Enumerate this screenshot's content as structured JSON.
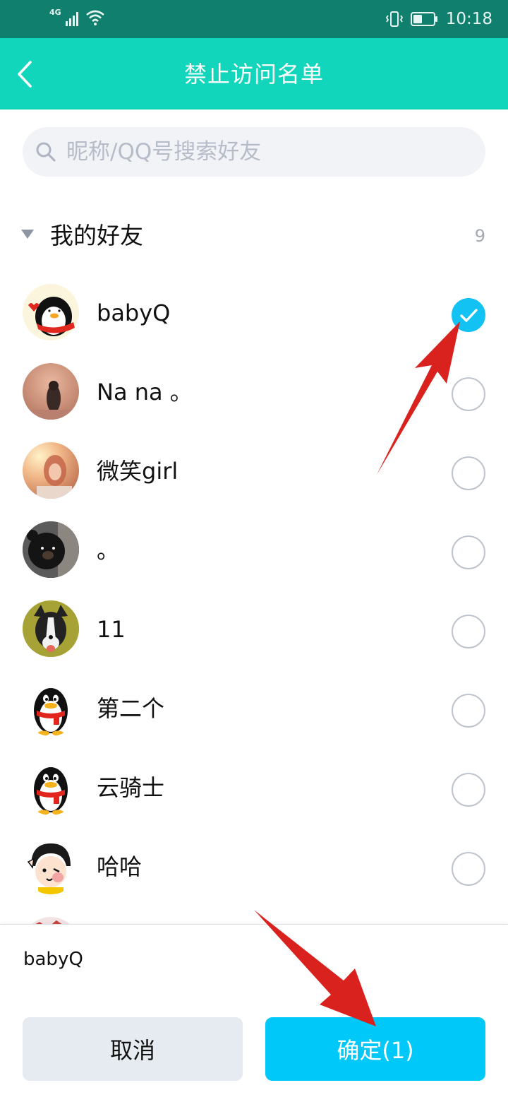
{
  "status_bar": {
    "network": "4G",
    "time": "10:18",
    "icons": [
      "signal-icon",
      "wifi-icon",
      "vibrate-icon",
      "battery-icon"
    ]
  },
  "header": {
    "title": "禁止访问名单",
    "back_icon": "back-arrow-icon"
  },
  "search": {
    "placeholder": "昵称/QQ号搜索好友",
    "value": ""
  },
  "group": {
    "name": "我的好友",
    "count": "9",
    "expanded": true
  },
  "friends": [
    {
      "name": "babyQ",
      "checked": true,
      "avatar": "penguin-scarf-avatar"
    },
    {
      "name": "Na na 。",
      "checked": false,
      "avatar": "photo-avatar"
    },
    {
      "name": "微笑girl",
      "checked": false,
      "avatar": "photo-avatar"
    },
    {
      "name": "。",
      "checked": false,
      "avatar": "bear-avatar"
    },
    {
      "name": "11",
      "checked": false,
      "avatar": "dog-avatar"
    },
    {
      "name": "第二个",
      "checked": false,
      "avatar": "qq-penguin-avatar"
    },
    {
      "name": "云骑士",
      "checked": false,
      "avatar": "qq-penguin-avatar"
    },
    {
      "name": "哈哈",
      "checked": false,
      "avatar": "cartoon-girl-avatar"
    }
  ],
  "footer": {
    "selected_text": "babyQ",
    "cancel_label": "取消",
    "confirm_label": "确定(1)"
  },
  "colors": {
    "status_bar": "#117f6e",
    "header": "#12d6bb",
    "check": "#12c2f2",
    "confirm_button": "#00c8f8",
    "annotation_arrow": "#d9221e"
  }
}
